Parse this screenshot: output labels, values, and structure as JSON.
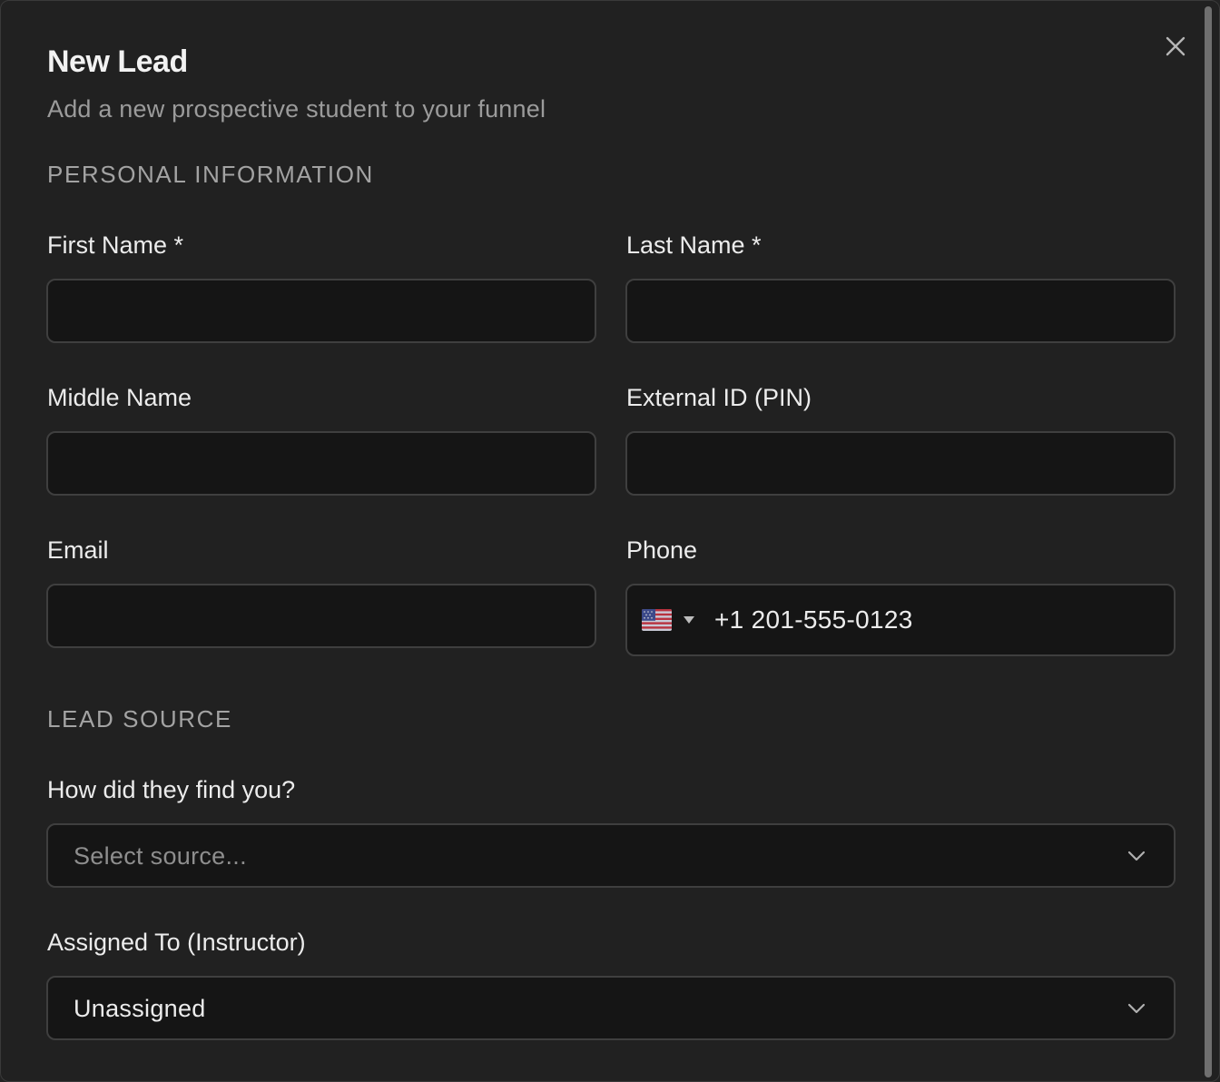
{
  "dialog": {
    "title": "New Lead",
    "subtitle": "Add a new prospective student to your funnel",
    "close_icon": "close-icon"
  },
  "personal_information": {
    "heading": "PERSONAL INFORMATION",
    "first_name": {
      "label": "First Name *",
      "value": ""
    },
    "last_name": {
      "label": "Last Name *",
      "value": ""
    },
    "middle_name": {
      "label": "Middle Name",
      "value": ""
    },
    "external_id": {
      "label": "External ID (PIN)",
      "value": ""
    },
    "email": {
      "label": "Email",
      "value": ""
    },
    "phone": {
      "label": "Phone",
      "country_flag_icon": "us-flag-icon",
      "value": "+1 201-555-0123"
    }
  },
  "lead_source": {
    "heading": "LEAD SOURCE",
    "source": {
      "label": "How did they find you?",
      "placeholder": "Select source..."
    },
    "assigned_to": {
      "label": "Assigned To (Instructor)",
      "value": "Unassigned"
    }
  },
  "colors": {
    "background": "#212121",
    "input_background": "#151515",
    "input_border": "#3f3f3f",
    "text_primary": "#ececec",
    "text_muted": "#9b9b9b"
  }
}
